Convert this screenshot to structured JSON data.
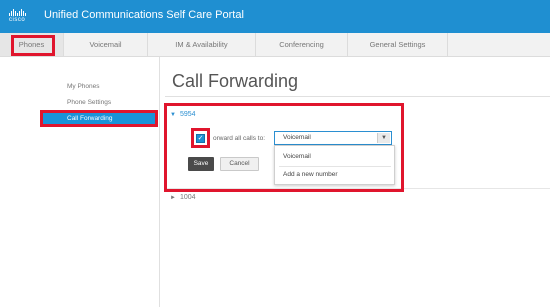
{
  "header": {
    "logo_text": "cisco",
    "title": "Unified Communications Self Care Portal"
  },
  "nav": {
    "tabs": [
      {
        "label": "Phones"
      },
      {
        "label": "Voicemail"
      },
      {
        "label": "IM & Availability"
      },
      {
        "label": "Conferencing"
      },
      {
        "label": "General Settings"
      }
    ]
  },
  "sidebar": {
    "items": [
      {
        "label": "My Phones"
      },
      {
        "label": "Phone Settings"
      },
      {
        "label": "Call Forwarding"
      }
    ]
  },
  "main": {
    "page_title": "Call Forwarding",
    "lines": [
      {
        "arrow": "▼",
        "number": "5954"
      },
      {
        "arrow": "►",
        "number": "1004"
      }
    ],
    "forward_label": "orward all calls to:",
    "forward_checked": true,
    "forward_select": {
      "value": "Voicemail",
      "options": [
        "Voicemail",
        "Add a new number"
      ]
    },
    "save_label": "Save",
    "cancel_label": "Cancel"
  },
  "colors": {
    "header_blue": "#1f8fd1",
    "active_sidebar": "#1a93d8",
    "highlight_red": "#e0152d"
  }
}
